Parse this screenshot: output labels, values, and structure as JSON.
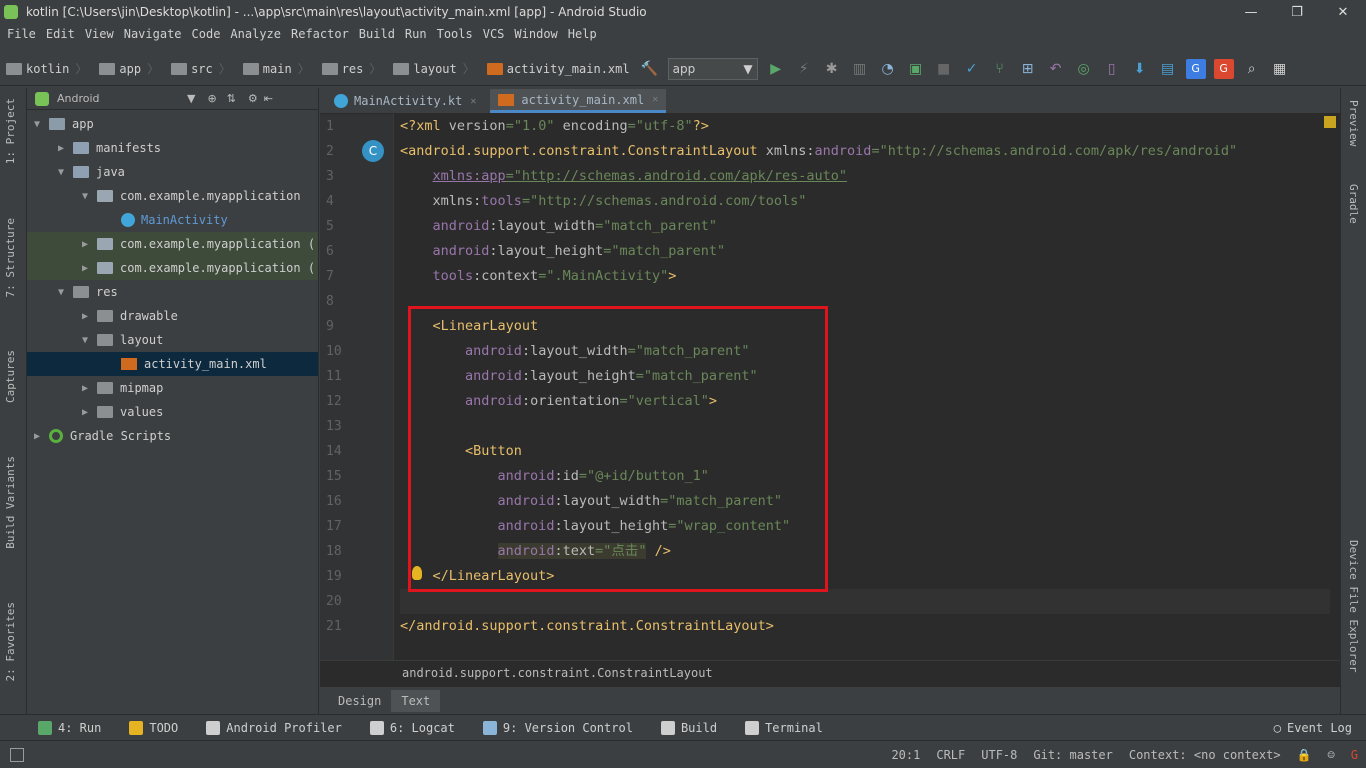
{
  "window": {
    "title": "kotlin [C:\\Users\\jin\\Desktop\\kotlin] - ...\\app\\src\\main\\res\\layout\\activity_main.xml [app] - Android Studio"
  },
  "menu": [
    "File",
    "Edit",
    "View",
    "Navigate",
    "Code",
    "Analyze",
    "Refactor",
    "Build",
    "Run",
    "Tools",
    "VCS",
    "Window",
    "Help"
  ],
  "breadcrumbs": [
    "kotlin",
    "app",
    "src",
    "main",
    "res",
    "layout",
    "activity_main.xml"
  ],
  "run_config": "app",
  "project_panel": {
    "view": "Android",
    "tree": [
      {
        "label": "app",
        "depth": 0,
        "arrow": "▼",
        "icon": "app"
      },
      {
        "label": "manifests",
        "depth": 1,
        "arrow": "▶",
        "icon": "folder"
      },
      {
        "label": "java",
        "depth": 1,
        "arrow": "▼",
        "icon": "folder"
      },
      {
        "label": "com.example.myapplication",
        "depth": 2,
        "arrow": "▼",
        "icon": "pkg"
      },
      {
        "label": "MainActivity",
        "depth": 3,
        "arrow": "",
        "icon": "kt"
      },
      {
        "label": "com.example.myapplication (",
        "depth": 2,
        "arrow": "▶",
        "icon": "pkg"
      },
      {
        "label": "com.example.myapplication (",
        "depth": 2,
        "arrow": "▶",
        "icon": "pkg"
      },
      {
        "label": "res",
        "depth": 1,
        "arrow": "▼",
        "icon": "res"
      },
      {
        "label": "drawable",
        "depth": 2,
        "arrow": "▶",
        "icon": "res"
      },
      {
        "label": "layout",
        "depth": 2,
        "arrow": "▼",
        "icon": "res"
      },
      {
        "label": "activity_main.xml",
        "depth": 3,
        "arrow": "",
        "icon": "xml",
        "selected": true
      },
      {
        "label": "mipmap",
        "depth": 2,
        "arrow": "▶",
        "icon": "res"
      },
      {
        "label": "values",
        "depth": 2,
        "arrow": "▶",
        "icon": "res"
      },
      {
        "label": "Gradle Scripts",
        "depth": 0,
        "arrow": "▶",
        "icon": "gradle"
      }
    ]
  },
  "left_tool_tabs": [
    "1: Project",
    "7: Structure",
    "Captures",
    "Build Variants",
    "2: Favorites"
  ],
  "right_tool_tabs": [
    "Preview",
    "Gradle",
    "Device File Explorer"
  ],
  "editor_tabs": [
    {
      "label": "MainActivity.kt",
      "active": false
    },
    {
      "label": "activity_main.xml",
      "active": true
    }
  ],
  "code_lines": [
    "1",
    "2",
    "3",
    "4",
    "5",
    "6",
    "7",
    "8",
    "9",
    "10",
    "11",
    "12",
    "13",
    "14",
    "15",
    "16",
    "17",
    "18",
    "19",
    "20",
    "21"
  ],
  "editor_breadcrumb": "android.support.constraint.ConstraintLayout",
  "design_tabs": {
    "design": "Design",
    "text": "Text"
  },
  "bottom_tools": [
    "4: Run",
    "TODO",
    "Android Profiler",
    "6: Logcat",
    "9: Version Control",
    "Build",
    "Terminal"
  ],
  "event_log": "Event Log",
  "status": {
    "position": "20:1",
    "line_sep": "CRLF",
    "encoding": "UTF-8",
    "git": "Git: master",
    "context": "Context: <no context>"
  }
}
